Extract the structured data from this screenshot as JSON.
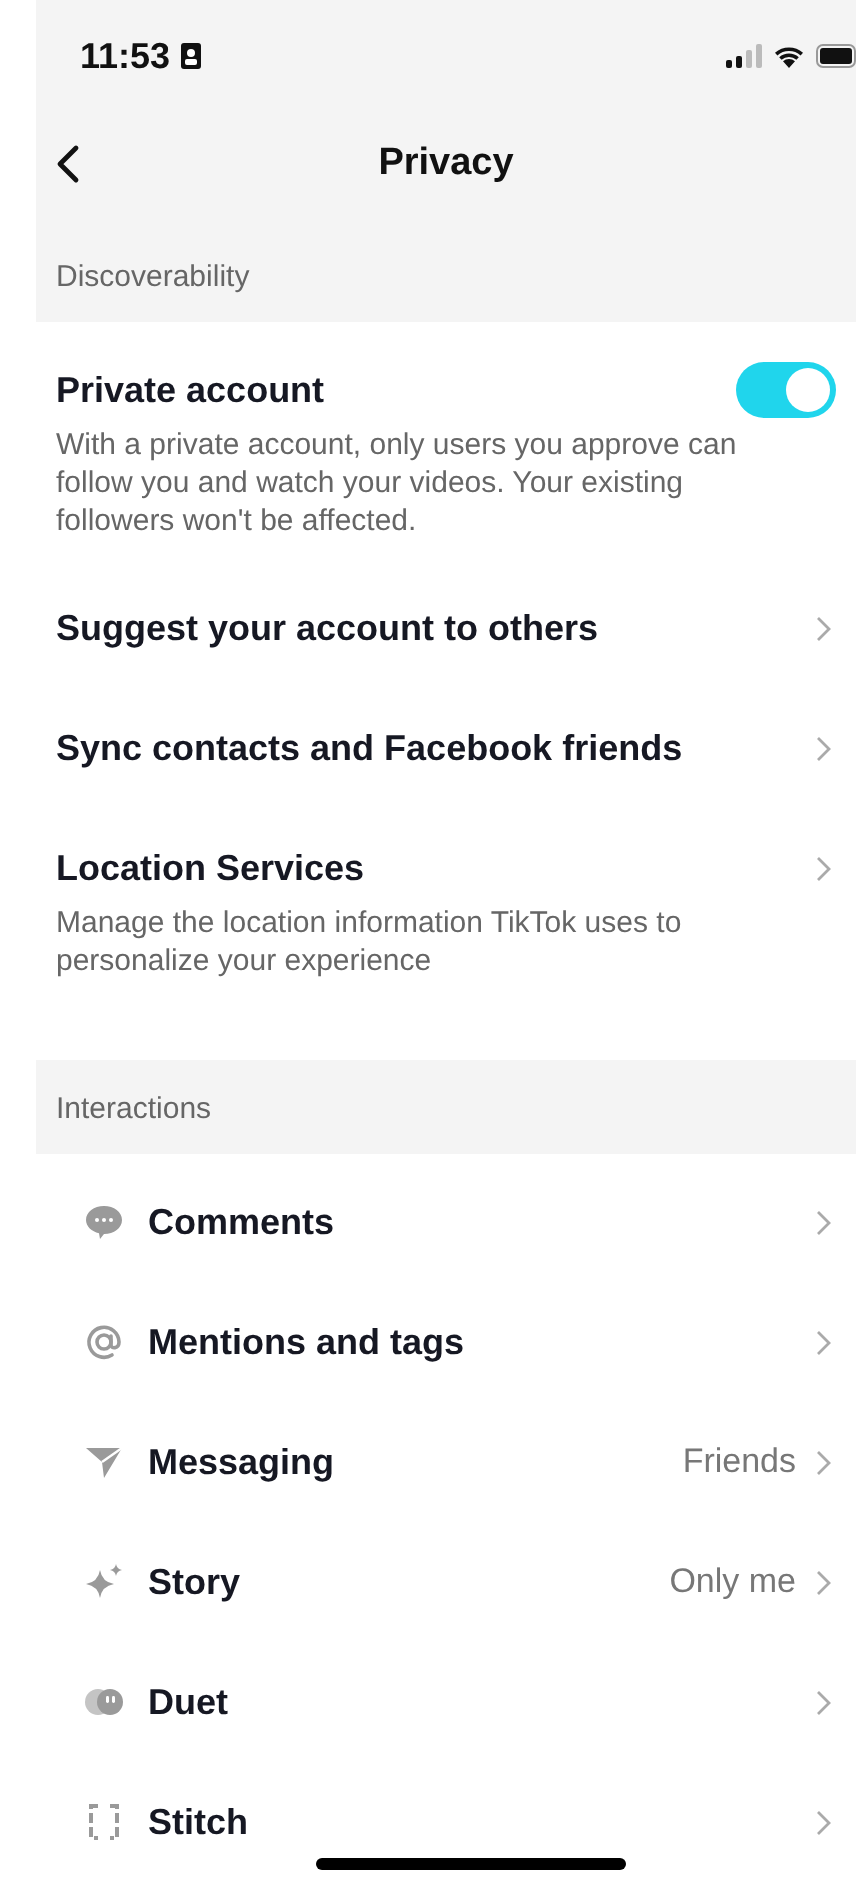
{
  "status_bar": {
    "time": "11:53"
  },
  "nav": {
    "title": "Privacy"
  },
  "sections": [
    {
      "header": "Discoverability",
      "items": [
        {
          "kind": "toggle",
          "label": "Private account",
          "on": true,
          "description": "With a private account, only users you approve can follow you and watch your videos. Your existing followers won't be affected."
        },
        {
          "kind": "link",
          "label": "Suggest your account to others"
        },
        {
          "kind": "link",
          "label": "Sync contacts and Facebook friends"
        },
        {
          "kind": "link",
          "label": "Location Services",
          "description": "Manage the location information TikTok uses to personalize your experience"
        }
      ]
    },
    {
      "header": "Interactions",
      "items": [
        {
          "kind": "icon_link",
          "label": "Comments"
        },
        {
          "kind": "icon_link",
          "label": "Mentions and tags"
        },
        {
          "kind": "icon_link",
          "label": "Messaging",
          "value": "Friends"
        },
        {
          "kind": "icon_link",
          "label": "Story",
          "value": "Only me"
        },
        {
          "kind": "icon_link",
          "label": "Duet"
        },
        {
          "kind": "icon_link",
          "label": "Stitch"
        }
      ]
    }
  ]
}
